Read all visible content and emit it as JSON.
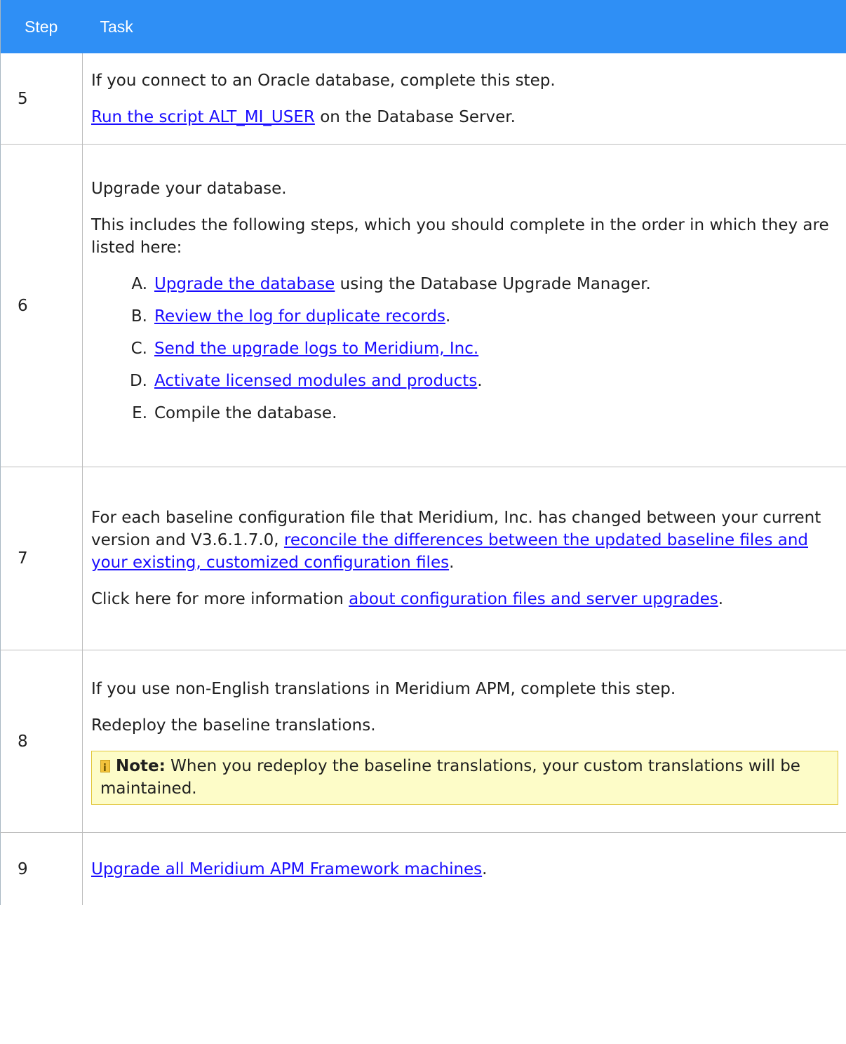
{
  "header": {
    "step": "Step",
    "task": "Task"
  },
  "rows": {
    "r5": {
      "num": "5",
      "line1": "If you connect to an Oracle database, complete this step.",
      "link": "Run the script ALT_MI_USER",
      "line2_rest": " on the Database Server."
    },
    "r6": {
      "num": "6",
      "line1": "Upgrade your database.",
      "line2": "This includes the following steps, which you should complete in the order in which they are listed here:",
      "items": [
        {
          "marker": "A.",
          "link": "Upgrade the database",
          "rest": " using the Database Upgrade Manager."
        },
        {
          "marker": "B.",
          "link": "Review the log for duplicate records",
          "rest": "."
        },
        {
          "marker": "C.",
          "link": "Send the upgrade logs to Meridium, Inc.",
          "rest": ""
        },
        {
          "marker": "D.",
          "link": "Activate licensed modules and products",
          "rest": "."
        },
        {
          "marker": "E.",
          "link": "",
          "rest": "Compile the database."
        }
      ]
    },
    "r7": {
      "num": "7",
      "p1_pre": "For each baseline configuration file that Meridium, Inc. has changed between your current version and V3.6.1.7.0, ",
      "p1_link": "reconcile the differences between the updated baseline files and your existing, customized configuration files",
      "p1_post": ".",
      "p2_pre": "Click here for more information ",
      "p2_link": "about configuration files and server upgrades",
      "p2_post": "."
    },
    "r8": {
      "num": "8",
      "line1": "If you use non-English translations in Meridium APM, complete this step.",
      "line2": " Redeploy the baseline translations.",
      "note_label": "Note:",
      "note_text": " When you redeploy the baseline translations, your custom translations will be maintained."
    },
    "r9": {
      "num": "9",
      "link": "Upgrade all Meridium APM Framework machines",
      "rest": "."
    }
  }
}
